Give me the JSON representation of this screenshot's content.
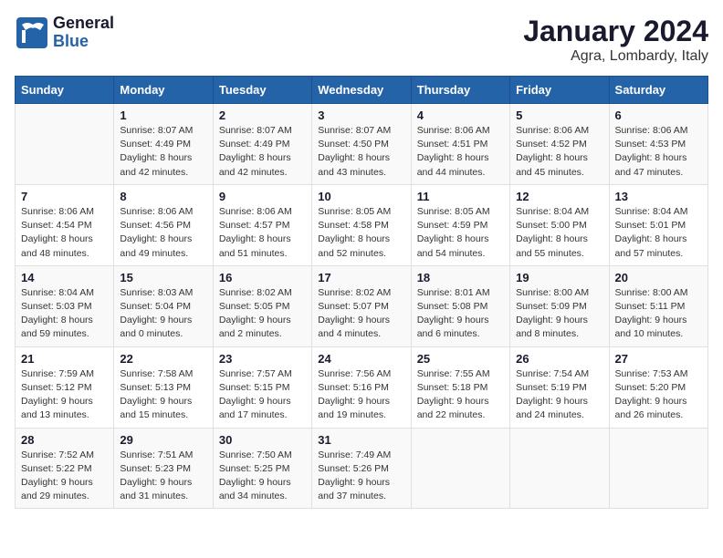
{
  "logo": {
    "line1": "General",
    "line2": "Blue"
  },
  "title": "January 2024",
  "subtitle": "Agra, Lombardy, Italy",
  "weekdays": [
    "Sunday",
    "Monday",
    "Tuesday",
    "Wednesday",
    "Thursday",
    "Friday",
    "Saturday"
  ],
  "weeks": [
    [
      {
        "day": "",
        "info": ""
      },
      {
        "day": "1",
        "info": "Sunrise: 8:07 AM\nSunset: 4:49 PM\nDaylight: 8 hours\nand 42 minutes."
      },
      {
        "day": "2",
        "info": "Sunrise: 8:07 AM\nSunset: 4:49 PM\nDaylight: 8 hours\nand 42 minutes."
      },
      {
        "day": "3",
        "info": "Sunrise: 8:07 AM\nSunset: 4:50 PM\nDaylight: 8 hours\nand 43 minutes."
      },
      {
        "day": "4",
        "info": "Sunrise: 8:06 AM\nSunset: 4:51 PM\nDaylight: 8 hours\nand 44 minutes."
      },
      {
        "day": "5",
        "info": "Sunrise: 8:06 AM\nSunset: 4:52 PM\nDaylight: 8 hours\nand 45 minutes."
      },
      {
        "day": "6",
        "info": "Sunrise: 8:06 AM\nSunset: 4:53 PM\nDaylight: 8 hours\nand 47 minutes."
      }
    ],
    [
      {
        "day": "7",
        "info": "Sunrise: 8:06 AM\nSunset: 4:54 PM\nDaylight: 8 hours\nand 48 minutes."
      },
      {
        "day": "8",
        "info": "Sunrise: 8:06 AM\nSunset: 4:56 PM\nDaylight: 8 hours\nand 49 minutes."
      },
      {
        "day": "9",
        "info": "Sunrise: 8:06 AM\nSunset: 4:57 PM\nDaylight: 8 hours\nand 51 minutes."
      },
      {
        "day": "10",
        "info": "Sunrise: 8:05 AM\nSunset: 4:58 PM\nDaylight: 8 hours\nand 52 minutes."
      },
      {
        "day": "11",
        "info": "Sunrise: 8:05 AM\nSunset: 4:59 PM\nDaylight: 8 hours\nand 54 minutes."
      },
      {
        "day": "12",
        "info": "Sunrise: 8:04 AM\nSunset: 5:00 PM\nDaylight: 8 hours\nand 55 minutes."
      },
      {
        "day": "13",
        "info": "Sunrise: 8:04 AM\nSunset: 5:01 PM\nDaylight: 8 hours\nand 57 minutes."
      }
    ],
    [
      {
        "day": "14",
        "info": "Sunrise: 8:04 AM\nSunset: 5:03 PM\nDaylight: 8 hours\nand 59 minutes."
      },
      {
        "day": "15",
        "info": "Sunrise: 8:03 AM\nSunset: 5:04 PM\nDaylight: 9 hours\nand 0 minutes."
      },
      {
        "day": "16",
        "info": "Sunrise: 8:02 AM\nSunset: 5:05 PM\nDaylight: 9 hours\nand 2 minutes."
      },
      {
        "day": "17",
        "info": "Sunrise: 8:02 AM\nSunset: 5:07 PM\nDaylight: 9 hours\nand 4 minutes."
      },
      {
        "day": "18",
        "info": "Sunrise: 8:01 AM\nSunset: 5:08 PM\nDaylight: 9 hours\nand 6 minutes."
      },
      {
        "day": "19",
        "info": "Sunrise: 8:00 AM\nSunset: 5:09 PM\nDaylight: 9 hours\nand 8 minutes."
      },
      {
        "day": "20",
        "info": "Sunrise: 8:00 AM\nSunset: 5:11 PM\nDaylight: 9 hours\nand 10 minutes."
      }
    ],
    [
      {
        "day": "21",
        "info": "Sunrise: 7:59 AM\nSunset: 5:12 PM\nDaylight: 9 hours\nand 13 minutes."
      },
      {
        "day": "22",
        "info": "Sunrise: 7:58 AM\nSunset: 5:13 PM\nDaylight: 9 hours\nand 15 minutes."
      },
      {
        "day": "23",
        "info": "Sunrise: 7:57 AM\nSunset: 5:15 PM\nDaylight: 9 hours\nand 17 minutes."
      },
      {
        "day": "24",
        "info": "Sunrise: 7:56 AM\nSunset: 5:16 PM\nDaylight: 9 hours\nand 19 minutes."
      },
      {
        "day": "25",
        "info": "Sunrise: 7:55 AM\nSunset: 5:18 PM\nDaylight: 9 hours\nand 22 minutes."
      },
      {
        "day": "26",
        "info": "Sunrise: 7:54 AM\nSunset: 5:19 PM\nDaylight: 9 hours\nand 24 minutes."
      },
      {
        "day": "27",
        "info": "Sunrise: 7:53 AM\nSunset: 5:20 PM\nDaylight: 9 hours\nand 26 minutes."
      }
    ],
    [
      {
        "day": "28",
        "info": "Sunrise: 7:52 AM\nSunset: 5:22 PM\nDaylight: 9 hours\nand 29 minutes."
      },
      {
        "day": "29",
        "info": "Sunrise: 7:51 AM\nSunset: 5:23 PM\nDaylight: 9 hours\nand 31 minutes."
      },
      {
        "day": "30",
        "info": "Sunrise: 7:50 AM\nSunset: 5:25 PM\nDaylight: 9 hours\nand 34 minutes."
      },
      {
        "day": "31",
        "info": "Sunrise: 7:49 AM\nSunset: 5:26 PM\nDaylight: 9 hours\nand 37 minutes."
      },
      {
        "day": "",
        "info": ""
      },
      {
        "day": "",
        "info": ""
      },
      {
        "day": "",
        "info": ""
      }
    ]
  ]
}
